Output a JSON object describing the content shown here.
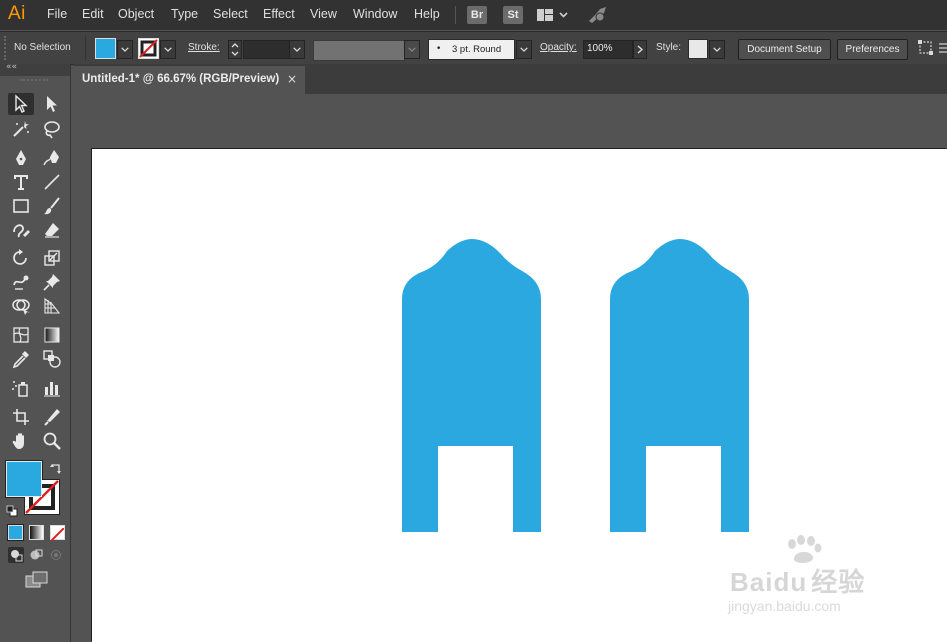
{
  "app": {
    "logo": "Ai"
  },
  "menu": [
    "File",
    "Edit",
    "Object",
    "Type",
    "Select",
    "Effect",
    "View",
    "Window",
    "Help"
  ],
  "menubar_badges": {
    "bridge": "Br",
    "stock": "St"
  },
  "control_bar": {
    "selection_status": "No Selection",
    "stroke_label": "Stroke:",
    "brush_value": "3 pt. Round",
    "opacity_label": "Opacity:",
    "opacity_value": "100%",
    "style_label": "Style:",
    "document_setup": "Document Setup",
    "preferences": "Preferences"
  },
  "document": {
    "tab_title": "Untitled-1* @ 66.67% (RGB/Preview)",
    "close_glyph": "×"
  },
  "colors": {
    "fill": "#29a9e0",
    "shape_fill": "#2aa8df",
    "accent_orange": "#ff9a00"
  },
  "watermark": {
    "brand": "Baidu",
    "brand_cn": "经验",
    "url": "jingyan.baidu.com"
  }
}
